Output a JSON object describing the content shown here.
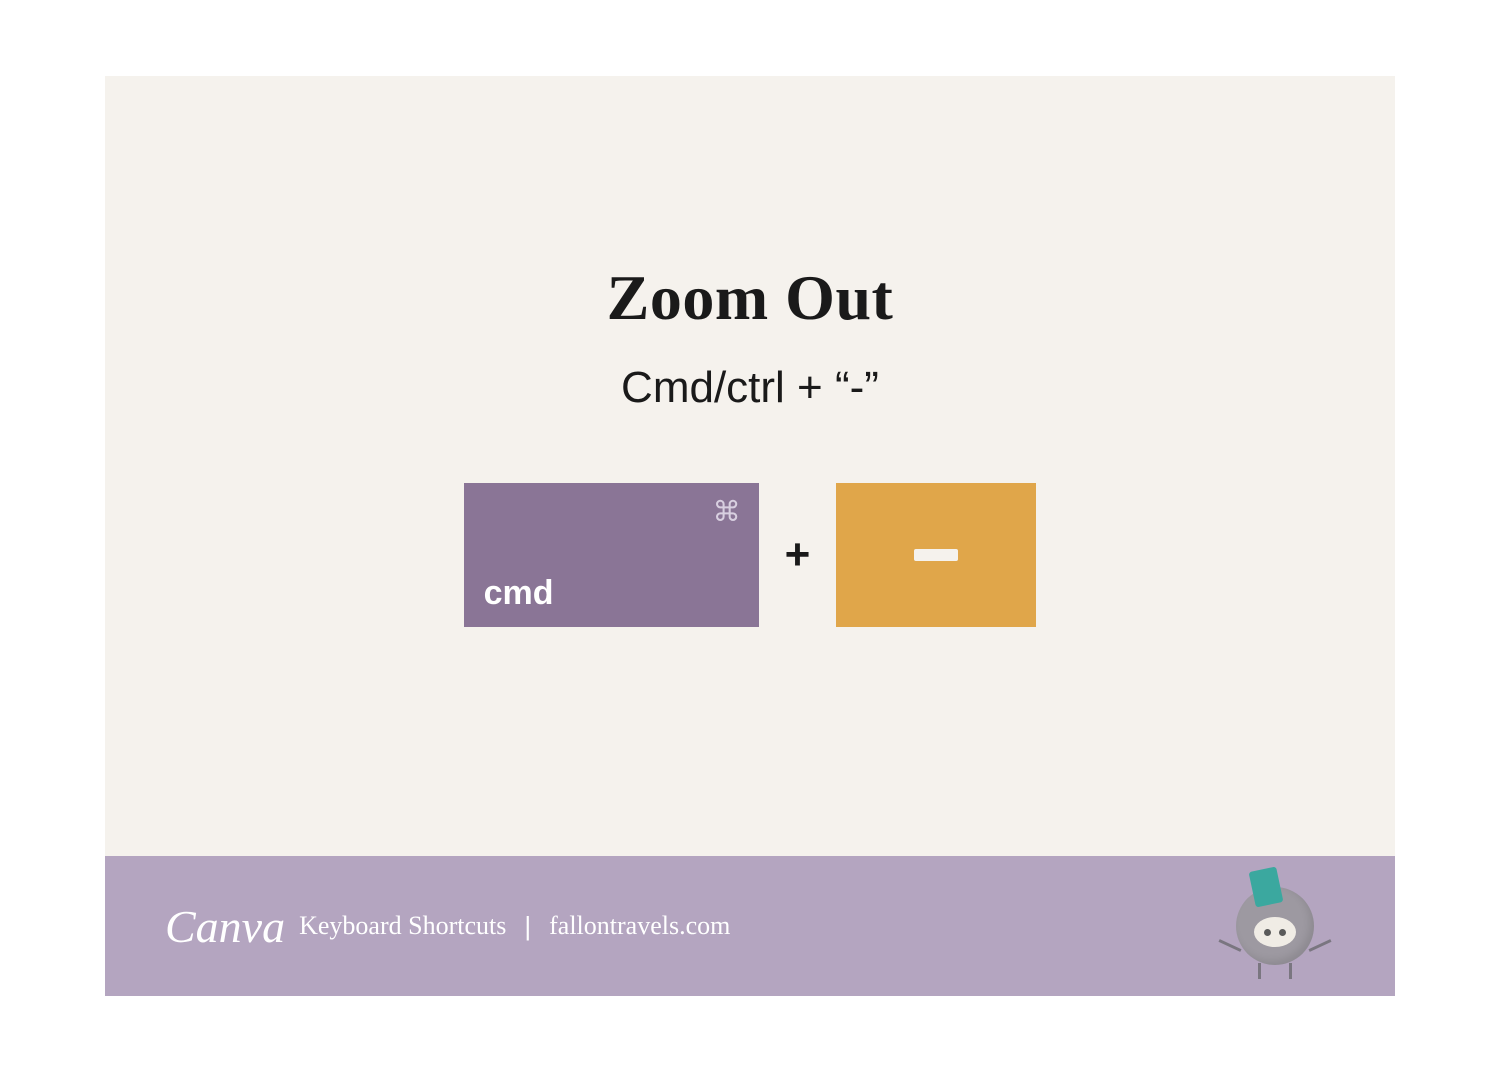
{
  "main": {
    "title": "Zoom Out",
    "subtitle": "Cmd/ctrl + “-”"
  },
  "keys": {
    "cmd_label": "cmd",
    "cmd_symbol": "⌘",
    "plus": "+"
  },
  "footer": {
    "logo_text": "Canva",
    "label": "Keyboard Shortcuts",
    "divider": "|",
    "site": "fallontravels.com"
  },
  "colors": {
    "background": "#f5f2ed",
    "cmd_key": "#8a7596",
    "minus_key": "#e0a64a",
    "footer_bg": "#b4a5c0"
  }
}
